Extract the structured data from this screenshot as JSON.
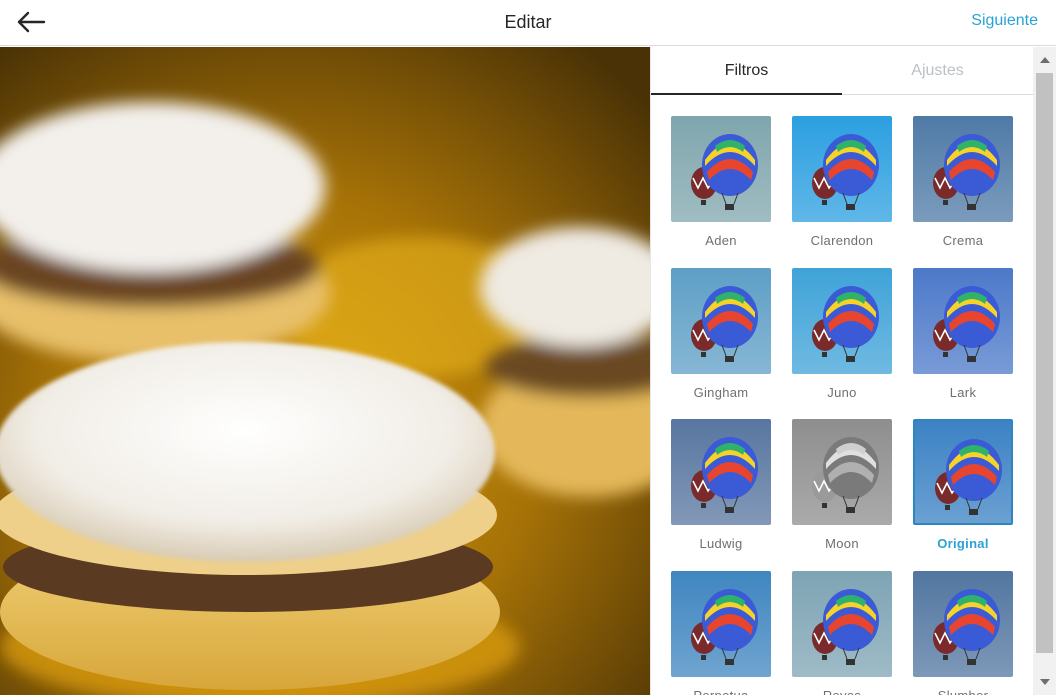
{
  "header": {
    "title": "Editar",
    "next_label": "Siguiente",
    "back_icon": "arrow-left-icon"
  },
  "tabs": [
    {
      "label": "Filtros",
      "active": true
    },
    {
      "label": "Ajustes",
      "active": false
    }
  ],
  "filters": [
    {
      "label": "Aden",
      "tint": "#7fa6ad",
      "selected": false
    },
    {
      "label": "Clarendon",
      "tint": "#2b9fe0",
      "selected": false
    },
    {
      "label": "Crema",
      "tint": "#4f7aa6",
      "selected": false
    },
    {
      "label": "Gingham",
      "tint": "#5e9fc6",
      "selected": false
    },
    {
      "label": "Juno",
      "tint": "#3fa3d8",
      "selected": false
    },
    {
      "label": "Lark",
      "tint": "#4c79c9",
      "selected": false
    },
    {
      "label": "Ludwig",
      "tint": "#5876a0",
      "selected": false
    },
    {
      "label": "Moon",
      "tint": "#8e8e8e",
      "selected": false
    },
    {
      "label": "Original",
      "tint": "#3c82c4",
      "selected": true
    },
    {
      "label": "Perpetua",
      "tint": "#3f86c0",
      "selected": false
    },
    {
      "label": "Reyes",
      "tint": "#7ea4b4",
      "selected": false
    },
    {
      "label": "Slumber",
      "tint": "#5276a0",
      "selected": false
    }
  ],
  "colors": {
    "accent": "#2aa2d4",
    "selected_border": "#2e86c1"
  }
}
